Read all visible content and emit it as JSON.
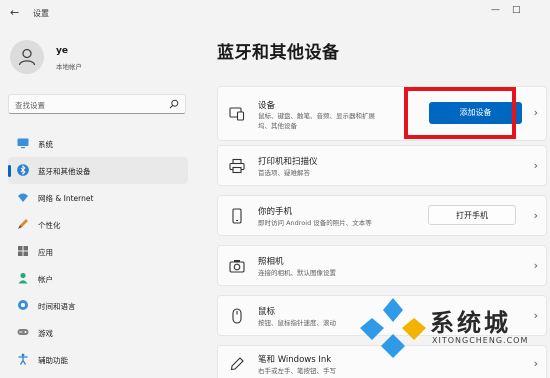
{
  "window": {
    "back_symbol": "←",
    "title": "设置",
    "minimize_symbol": "—",
    "maximize_symbol": "□"
  },
  "user": {
    "name": "ye",
    "account_type": "本地帐户"
  },
  "search": {
    "placeholder": "查找设置"
  },
  "sidebar": {
    "items": [
      {
        "label": "系统",
        "icon": "monitor-icon"
      },
      {
        "label": "蓝牙和其他设备",
        "icon": "bluetooth-icon",
        "active": true
      },
      {
        "label": "网络 & Internet",
        "icon": "wifi-icon"
      },
      {
        "label": "个性化",
        "icon": "brush-icon"
      },
      {
        "label": "应用",
        "icon": "apps-icon"
      },
      {
        "label": "帐户",
        "icon": "person-icon"
      },
      {
        "label": "时间和语言",
        "icon": "globe-icon"
      },
      {
        "label": "游戏",
        "icon": "gamepad-icon"
      },
      {
        "label": "辅助功能",
        "icon": "accessibility-icon"
      }
    ]
  },
  "page": {
    "title": "蓝牙和其他设备"
  },
  "cards": {
    "devices": {
      "title": "设备",
      "desc1": "鼠标、键盘、触笔、音频、显示器和扩展",
      "desc2": "坞、其他设备",
      "button": "添加设备",
      "chevron": "›"
    },
    "printers": {
      "title": "打印机和扫描仪",
      "desc": "首选项、疑难解答",
      "chevron": "›"
    },
    "phone": {
      "title": "你的手机",
      "desc": "即时访问 Android 设备的照片、文本等",
      "button": "打开手机",
      "chevron": "›"
    },
    "cameras": {
      "title": "照相机",
      "desc": "连接的相机、默认图像设置",
      "chevron": "›"
    },
    "mouse": {
      "title": "鼠标",
      "desc": "按钮、鼠标指针速度、滚动",
      "chevron": "›"
    },
    "pen": {
      "title": "笔和 Windows Ink",
      "desc": "右手或左手、笔按钮、手写",
      "chevron": "›"
    }
  },
  "watermark": {
    "text": "系统城",
    "url": "XITONGCHENG.COM"
  },
  "colors": {
    "accent": "#0067c0",
    "highlight_box": "#e3141b",
    "background": "#f3f3f3",
    "card": "#fbfbfb"
  }
}
